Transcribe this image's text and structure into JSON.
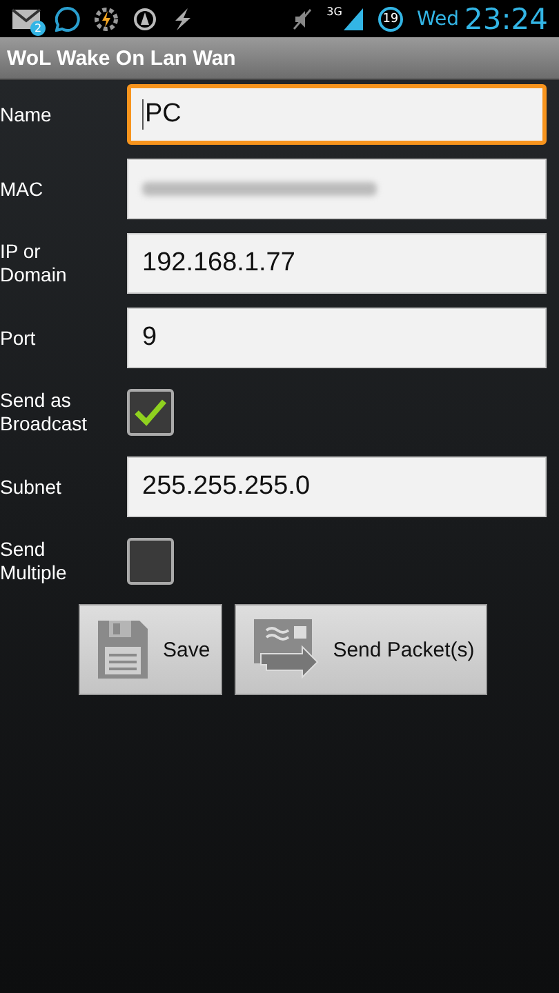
{
  "status_bar": {
    "mail_badge": "2",
    "network": "3G",
    "battery": "19",
    "day": "Wed",
    "time": "23:24"
  },
  "window": {
    "title": "WoL Wake On Lan Wan"
  },
  "fields": [
    {
      "kind": "text",
      "label": "Name",
      "value": "PC",
      "focused": true
    },
    {
      "kind": "blurred",
      "label": "MAC",
      "focused": false
    },
    {
      "kind": "text",
      "label": "IP or Domain",
      "value": "192.168.1.77",
      "focused": false
    },
    {
      "kind": "text",
      "label": "Port",
      "value": "9",
      "focused": false
    },
    {
      "kind": "checkbox",
      "label": "Send as Broadcast",
      "checked": true
    },
    {
      "kind": "text",
      "label": "Subnet",
      "value": "255.255.255.0",
      "focused": false
    },
    {
      "kind": "checkbox",
      "label": "Send Multiple",
      "checked": false
    }
  ],
  "buttons": [
    {
      "kind": "save",
      "label": "Save"
    },
    {
      "kind": "send",
      "label": "Send Packet(s)"
    }
  ]
}
